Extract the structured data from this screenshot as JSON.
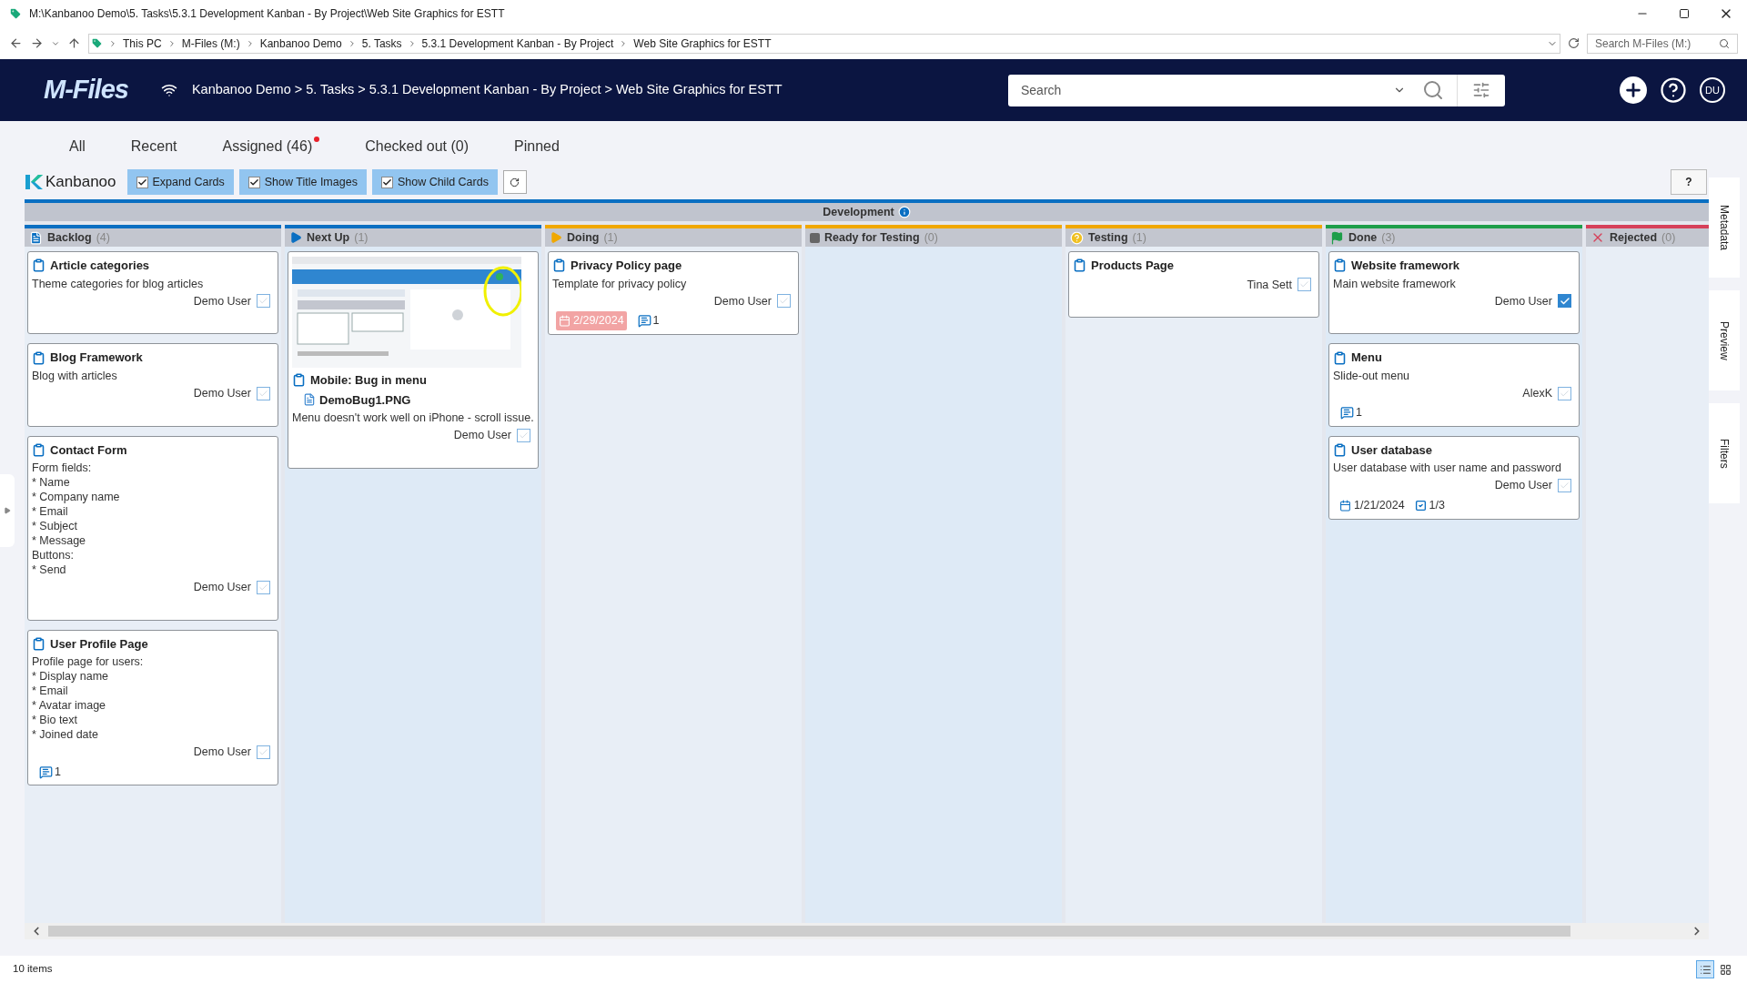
{
  "window": {
    "title": "M:\\Kanbanoo Demo\\5. Tasks\\5.3.1 Development Kanban - By Project\\Web Site Graphics for ESTT"
  },
  "address_bar": {
    "crumbs": [
      "This PC",
      "M-Files (M:)",
      "Kanbanoo Demo",
      "5. Tasks",
      "5.3.1 Development Kanban - By Project",
      "Web Site Graphics for ESTT"
    ],
    "search": {
      "placeholder": "Search M-Files (M:)"
    }
  },
  "header": {
    "logo": "M-Files",
    "breadcrumb": "Kanbanoo Demo > 5. Tasks > 5.3.1 Development Kanban - By Project > Web Site Graphics for ESTT",
    "search": {
      "placeholder": "Search"
    },
    "avatar": "DU"
  },
  "tabs": [
    {
      "label": "All",
      "selected": false,
      "notification": false
    },
    {
      "label": "Recent",
      "selected": false,
      "notification": false
    },
    {
      "label": "Assigned (46)",
      "selected": false,
      "notification": true
    },
    {
      "label": "Checked out (0)",
      "selected": false,
      "notification": false
    },
    {
      "label": "Pinned",
      "selected": false,
      "notification": false
    }
  ],
  "toolbar": {
    "brand": "Kanbanoo",
    "toggles": [
      {
        "label": "Expand Cards",
        "checked": true
      },
      {
        "label": "Show Title Images",
        "checked": true
      },
      {
        "label": "Show Child Cards",
        "checked": true
      }
    ],
    "help": "?"
  },
  "board": {
    "group": "Development",
    "columns": [
      {
        "kind": "backlog",
        "name": "Backlog",
        "count": "(4)",
        "color": "#0a6fc2",
        "cards": [
          {
            "title": "Article categories",
            "description": "Theme categories for blog articles",
            "assignee": "Demo User",
            "checked": false
          },
          {
            "title": "Blog Framework",
            "description": "Blog with articles",
            "assignee": "Demo User",
            "checked": false
          },
          {
            "title": "Contact Form",
            "description": "Form fields:\n* Name\n* Company name\n* Email\n* Subject\n* Message\nButtons:\n* Send",
            "assignee": "Demo User",
            "checked": false
          },
          {
            "title": "User Profile Page",
            "description": "Profile page for users:\n* Display name\n* Email\n* Avatar image\n* Bio text\n* Joined date",
            "assignee": "Demo User",
            "checked": false,
            "comments": "1"
          }
        ]
      },
      {
        "kind": "next",
        "name": "Next Up",
        "count": "(1)",
        "color": "#0a6fc2",
        "cards": [
          {
            "title": "Mobile: Bug in menu",
            "attachment": "DemoBug1.PNG",
            "description": "Menu doesn't work well on iPhone - scroll issue.",
            "assignee": "Demo User",
            "checked": false
          }
        ]
      },
      {
        "kind": "doing",
        "name": "Doing",
        "count": "(1)",
        "color": "#f0a800",
        "cards": [
          {
            "title": "Privacy Policy page",
            "description": "Template for privacy policy",
            "assignee": "Demo User",
            "checked": false,
            "date": {
              "text": "2/29/2024",
              "overdue": true
            },
            "comments": "1"
          }
        ]
      },
      {
        "kind": "ready",
        "name": "Ready for Testing",
        "count": "(0)",
        "color": "#f0a800"
      },
      {
        "kind": "testing",
        "name": "Testing",
        "count": "(1)",
        "color": "#f0a800",
        "cards": [
          {
            "title": "Products Page",
            "assignee": "Tina Sett",
            "checked": false
          }
        ]
      },
      {
        "kind": "done",
        "name": "Done",
        "count": "(3)",
        "color": "#1e9e4a",
        "cards": [
          {
            "title": "Website framework",
            "description": "Main website framework",
            "assignee": "Demo User",
            "checked": true
          },
          {
            "title": "Menu",
            "description": "Slide-out menu",
            "assignee": "AlexK",
            "checked": false,
            "comments": "1"
          },
          {
            "title": "User database",
            "description": "User database with user name and password",
            "assignee": "Demo User",
            "checked": false,
            "date": {
              "text": "1/21/2024",
              "overdue": false
            },
            "tasks": "1/3"
          }
        ]
      },
      {
        "kind": "rejected",
        "name": "Rejected",
        "count": "(0)",
        "color": "#d6405a"
      }
    ]
  },
  "side_tabs": [
    "Metadata",
    "Preview",
    "Filters"
  ],
  "status_bar": {
    "text": "10 items",
    "views": [
      {
        "kind": "details",
        "selected": true
      },
      {
        "kind": "large-icons",
        "selected": false
      }
    ]
  }
}
